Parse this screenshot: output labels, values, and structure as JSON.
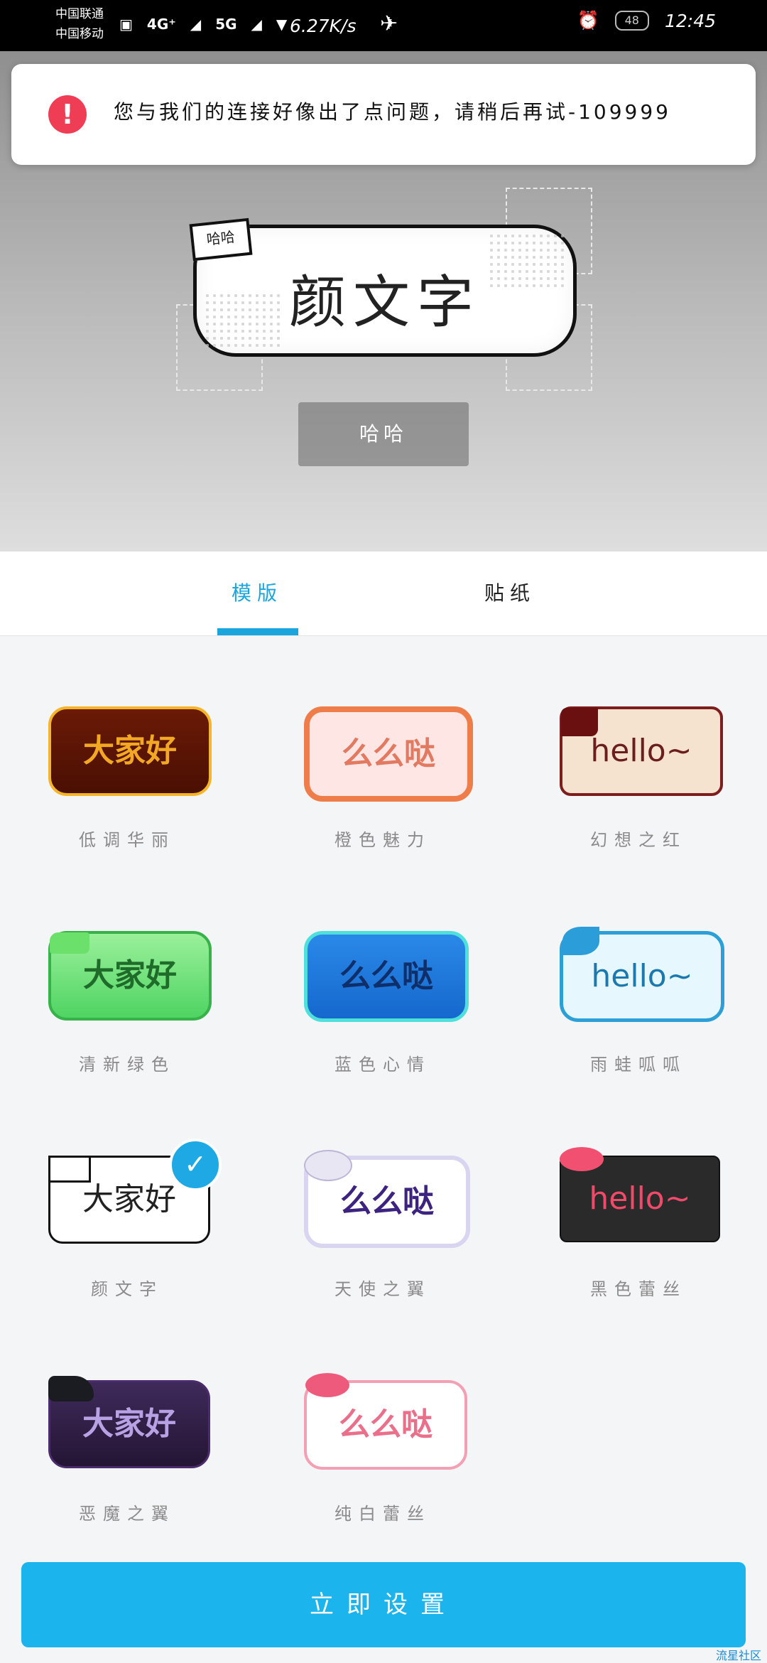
{
  "status_bar": {
    "carrier_1": "中国联通",
    "carrier_2": "中国移动",
    "network_1": "4G⁺",
    "network_2": "5G",
    "speed": "6.27K/s",
    "battery": "48",
    "time": "12:45"
  },
  "toast": {
    "icon": "!",
    "message": "您与我们的连接好像出了点问题，请稍后再试-109999"
  },
  "preview": {
    "bubble_tag": "哈哈",
    "bubble_text": "颜文字",
    "input_text": "哈哈"
  },
  "tabs": [
    {
      "label": "模版"
    },
    {
      "label": "贴纸"
    }
  ],
  "templates": [
    {
      "sample": "大家好",
      "label": "低调华丽"
    },
    {
      "sample": "么么哒",
      "label": "橙色魅力"
    },
    {
      "sample": "hello~",
      "label": "幻想之红"
    },
    {
      "sample": "大家好",
      "label": "清新绿色"
    },
    {
      "sample": "么么哒",
      "label": "蓝色心情"
    },
    {
      "sample": "hello~",
      "label": "雨蛙呱呱"
    },
    {
      "sample": "大家好",
      "label": "颜文字"
    },
    {
      "sample": "么么哒",
      "label": "天使之翼"
    },
    {
      "sample": "hello~",
      "label": "黑色蕾丝"
    },
    {
      "sample": "大家好",
      "label": "恶魔之翼"
    },
    {
      "sample": "么么哒",
      "label": "纯白蕾丝"
    }
  ],
  "cta": {
    "label": "立即设置"
  },
  "footer": {
    "community": "流星社区"
  },
  "colors": {
    "accent": "#1aa6dc",
    "cta_bg": "#1cb4ec",
    "error": "#ef3d56"
  }
}
